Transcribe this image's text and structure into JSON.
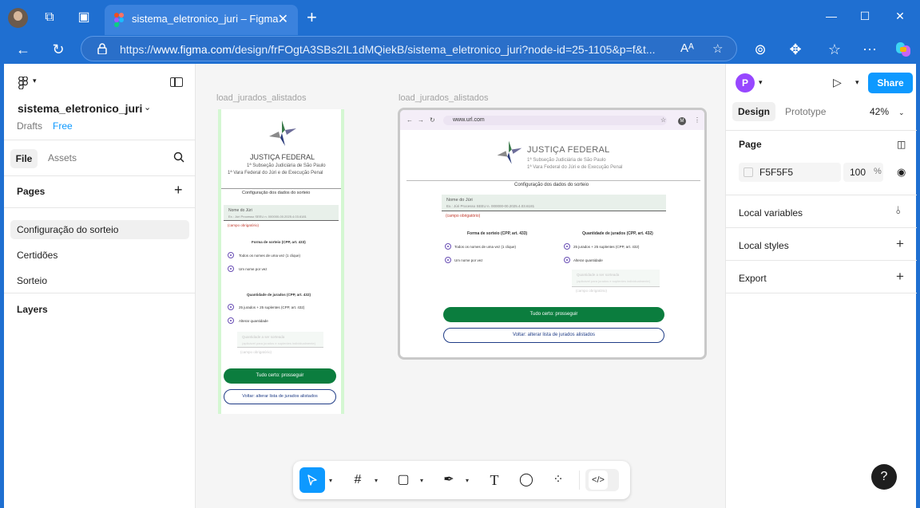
{
  "browser": {
    "tab_title": "sistema_eletronico_juri – Figma",
    "url_prefix": "https://",
    "url_host": "www.figma.com",
    "url_path": "/design/frFOgtA3SBs2IL1dMQiekB/sistema_eletronico_juri?node-id=25-1105&p=f&t..."
  },
  "left_panel": {
    "file_name": "sistema_eletronico_juri",
    "drafts": "Drafts",
    "plan": "Free",
    "tab_file": "File",
    "tab_assets": "Assets",
    "pages_heading": "Pages",
    "pages": [
      {
        "label": "Configuração do sorteio",
        "active": true
      },
      {
        "label": "Certidões",
        "active": false
      },
      {
        "label": "Sorteio",
        "active": false
      }
    ],
    "layers_heading": "Layers"
  },
  "canvas": {
    "frame_mobile_label": "load_jurados_alistados",
    "frame_tablet_label": "load_jurados_alistados",
    "design": {
      "org": "JUSTIÇA FEDERAL",
      "sub1": "1ª Subseção Judiciária de São Paulo",
      "sub2": "1ª Vara Federal do Júri e de Execução Penal",
      "section_title": "Configuração dos dados do sorteio",
      "field_label": "Nome do Júri",
      "field_placeholder": "Ex.: Júri Processo SEEU n. 000000-00.2025.4.03.6181",
      "required": "(campo obrigatório)",
      "group1_title": "Forma de sorteio (CPP, art. 433)",
      "group1_opt1": "Todos os nomes de uma vez (1 clique)",
      "group1_opt2": "Um nome por vez",
      "group2_title": "Quantidade de jurados (CPP, art. 432)",
      "group2_opt1": "25 jurados + 25 suplentes (CPP, art. 432)",
      "group2_opt2": "Alterar quantidade",
      "qty_label": "Quantidade a ser sorteada",
      "qty_hint": "(aplicável para jurados e suplentes individualmente)",
      "btn_primary": "Tudo certo: prosseguir",
      "btn_secondary": "Voltar: alterar lista de jurados alistados",
      "mock_url": "www.url.com",
      "mock_avatar": "M"
    }
  },
  "right_panel": {
    "avatar_letter": "P",
    "share": "Share",
    "tab_design": "Design",
    "tab_prototype": "Prototype",
    "zoom": "42%",
    "page_heading": "Page",
    "page_color": "F5F5F5",
    "page_opacity": "100",
    "percent": "%",
    "local_variables": "Local variables",
    "local_styles": "Local styles",
    "export": "Export"
  },
  "help_label": "?"
}
